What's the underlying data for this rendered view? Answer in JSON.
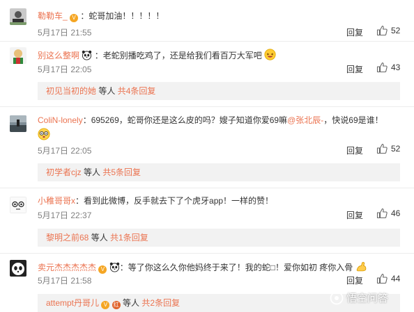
{
  "comments": [
    {
      "username": "勒勒车_",
      "separator": "：",
      "text": "蛇哥加油！！！！！",
      "time": "5月17日 21:55",
      "reply": "回复",
      "likes": "52"
    },
    {
      "username": "别这么整啊",
      "separator": "：",
      "text": "老蛇别播吃鸡了，还是给我们看百万大军吧",
      "time": "5月17日 22:05",
      "reply": "回复",
      "likes": "43",
      "sub": {
        "name": "初见当初的她",
        "etc": " 等人 ",
        "count": "共4条回复"
      }
    },
    {
      "username": "ColiN-lonely",
      "separator": "：",
      "text_a": "695269，蛇哥你还是这么皮的吗？嫂子知道你爱69嘛",
      "mention": "@张北辰-",
      "text_b": "，快说69是谁！",
      "time": "5月17日 22:05",
      "reply": "回复",
      "likes": "52",
      "sub": {
        "name": "初学者cjz",
        "etc": " 等人 ",
        "count": "共5条回复"
      }
    },
    {
      "username": "小稚哥哥x",
      "separator": "：",
      "text": "看到此微博，反手就去下了个虎牙app！一样的赞！",
      "time": "5月17日 22:37",
      "reply": "回复",
      "likes": "46",
      "sub": {
        "name": "黎明之前68",
        "etc": " 等人 ",
        "count": "共1条回复"
      }
    },
    {
      "username": "卖元杰杰杰杰杰",
      "separator": "：",
      "text": "等了你这么久你他妈终于来了！我的蛇□！爱你如初 疼你入骨",
      "time": "5月17日 21:58",
      "reply": "回复",
      "likes": "44",
      "sub": {
        "name": "attempt丹哥儿",
        "etc": " 等人 ",
        "count": "共2条回复"
      }
    }
  ],
  "watermark": "悟空问答",
  "colors": {
    "link": "#eb7350",
    "muted": "#808080",
    "subbg": "#f2f2f2"
  }
}
